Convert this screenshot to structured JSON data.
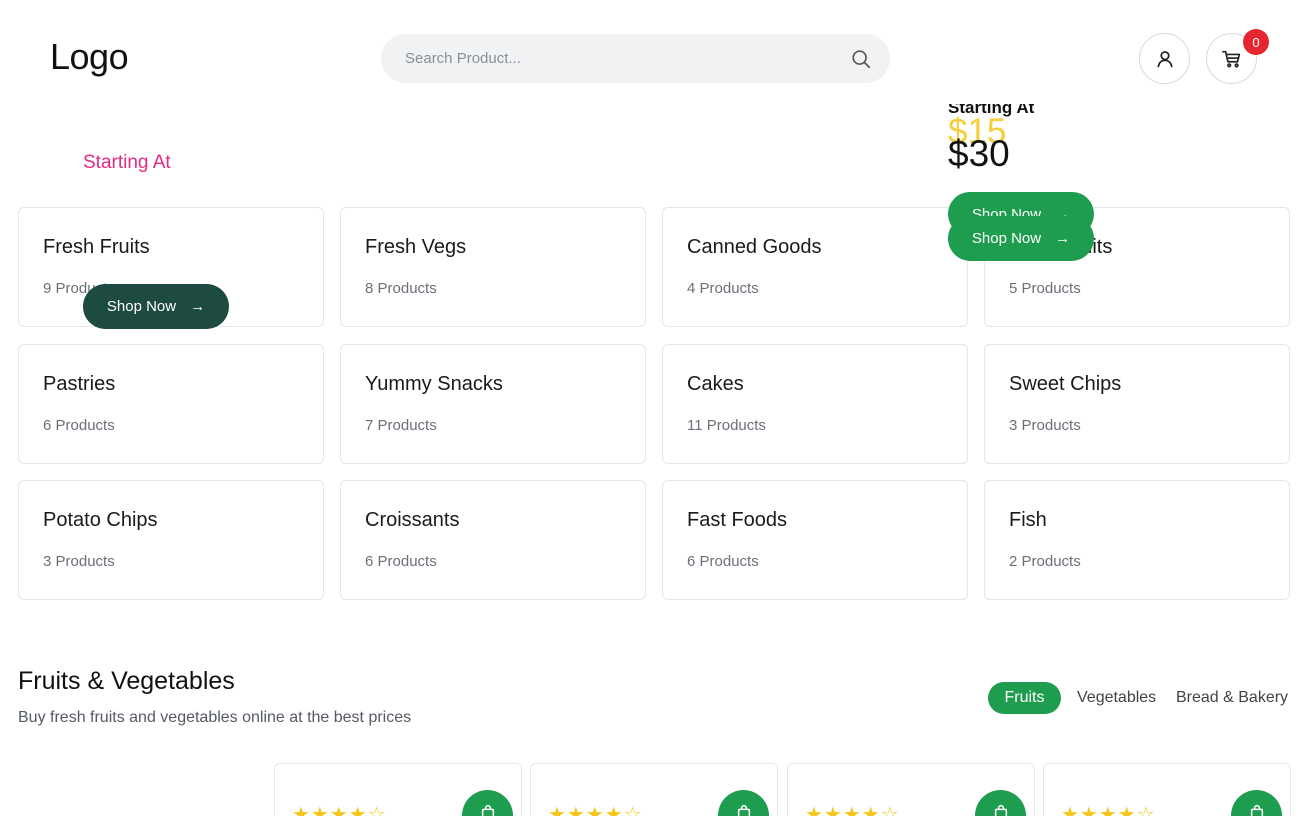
{
  "header": {
    "logo": "Logo",
    "search_placeholder": "Search Product...",
    "cart_count": "0"
  },
  "banner": {
    "starting_at_left": "Starting At",
    "starting_at_right": "Starting At",
    "price_yellow": "$15",
    "price_black": "$30",
    "shop_now": "Shop Now",
    "arrow": "→"
  },
  "categories": [
    {
      "title": "Fresh Fruits",
      "count": "9 Products"
    },
    {
      "title": "Fresh Vegs",
      "count": "8 Products"
    },
    {
      "title": "Canned Goods",
      "count": "4 Products"
    },
    {
      "title": "Dried Fruits",
      "count": "5 Products"
    },
    {
      "title": "Pastries",
      "count": "6 Products"
    },
    {
      "title": "Yummy Snacks",
      "count": "7 Products"
    },
    {
      "title": "Cakes",
      "count": "11 Products"
    },
    {
      "title": "Sweet Chips",
      "count": "3 Products"
    },
    {
      "title": "Potato Chips",
      "count": "3 Products"
    },
    {
      "title": "Croissants",
      "count": "6 Products"
    },
    {
      "title": "Fast Foods",
      "count": "6 Products"
    },
    {
      "title": "Fish",
      "count": "2 Products"
    }
  ],
  "section": {
    "title": "Fruits & Vegetables",
    "subtitle": "Buy fresh fruits and vegetables online at the best prices",
    "tabs": [
      "Fruits",
      "Vegetables",
      "Bread & Bakery"
    ]
  },
  "products": {
    "stars_filled": "★★★★",
    "stars_empty": "☆"
  },
  "colors": {
    "accent_green": "#1f9d4f",
    "dark_green": "#1d4b42",
    "pink": "#e32a84",
    "yellow": "#f5c518",
    "badge_red": "#e3262f"
  },
  "icons": [
    "search-icon",
    "user-icon",
    "cart-icon",
    "arrow-right-icon",
    "shopping-bag-icon",
    "star-icon"
  ]
}
